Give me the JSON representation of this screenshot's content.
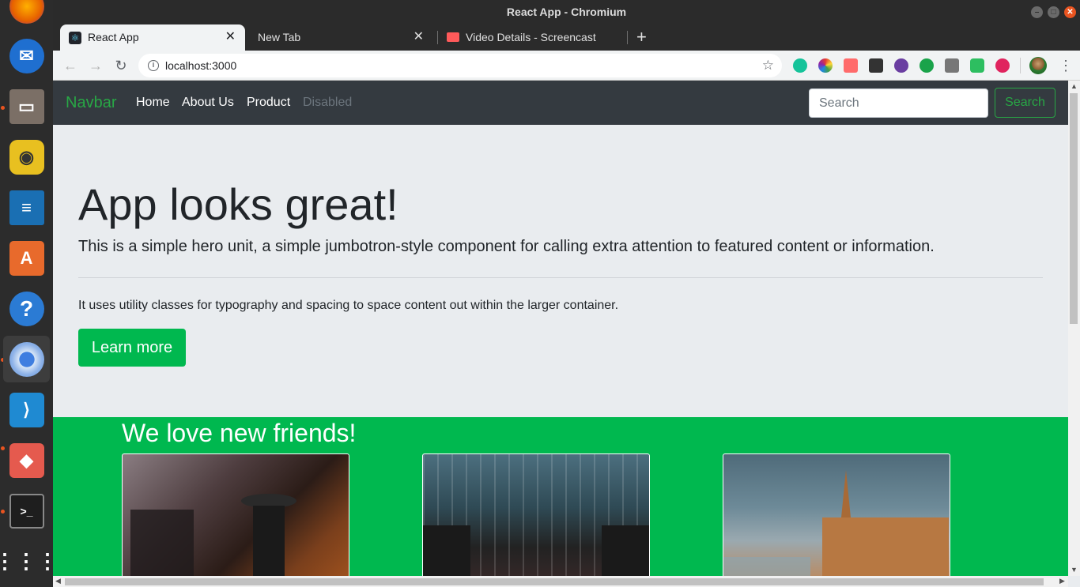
{
  "window": {
    "title": "React App - Chromium"
  },
  "tabs": [
    {
      "label": "React App",
      "active": true
    },
    {
      "label": "New Tab",
      "active": false
    },
    {
      "label": "Video Details - Screencast",
      "active": false
    }
  ],
  "toolbar": {
    "url": "localhost:3000",
    "new_tab": "+"
  },
  "navbar": {
    "brand": "Navbar",
    "links": [
      "Home",
      "About Us",
      "Product",
      "Disabled"
    ],
    "search_placeholder": "Search",
    "search_button": "Search"
  },
  "hero": {
    "title": "App looks great!",
    "lead": "This is a simple hero unit, a simple jumbotron-style component for calling extra attention to featured content or information.",
    "text": "It uses utility classes for typography and spacing to space content out within the larger container.",
    "button": "Learn more"
  },
  "friends": {
    "title": "We love new friends!"
  },
  "colors": {
    "accent": "#00b84f",
    "navbar": "#343a40",
    "jumbotron": "#e9ecef"
  },
  "dock_icons": [
    "firefox-icon",
    "thunderbird-icon",
    "files-icon",
    "rhythmbox-icon",
    "writer-icon",
    "software-icon",
    "help-icon",
    "chromium-icon",
    "vscode-icon",
    "package-icon",
    "terminal-icon",
    "apps-grid-icon"
  ]
}
